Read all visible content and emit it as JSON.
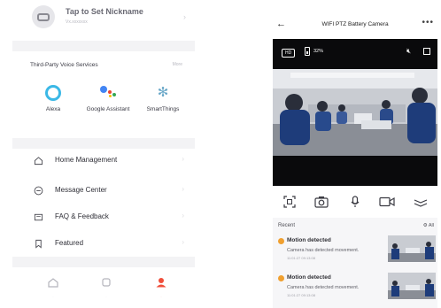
{
  "me_screen": {
    "profile": {
      "title": "Tap to Set Nickname",
      "subtitle": "Vx.xxxxxxx"
    },
    "voice_services": {
      "title": "Third-Party Voice Services",
      "more": "More",
      "items": [
        {
          "label": "Alexa",
          "icon": "alexa-icon"
        },
        {
          "label": "Google Assistant",
          "icon": "google-assistant-icon"
        },
        {
          "label": "SmartThings",
          "icon": "smartthings-icon"
        }
      ]
    },
    "menu": [
      {
        "label": "Home Management",
        "icon": "home-icon"
      },
      {
        "label": "Message Center",
        "icon": "message-icon"
      },
      {
        "label": "FAQ & Feedback",
        "icon": "feedback-icon"
      },
      {
        "label": "Featured",
        "icon": "bookmark-icon"
      }
    ],
    "tabs": [
      {
        "icon": "home-tab-icon"
      },
      {
        "icon": "smart-tab-icon"
      },
      {
        "icon": "me-tab-icon",
        "active": true
      }
    ],
    "accent_color": "#f04e3a"
  },
  "camera_screen": {
    "title": "WIFI PTZ Battery Camera",
    "video": {
      "quality_badge": "HD",
      "battery_pct": "32%",
      "battery_level": 0.32
    },
    "controls": [
      {
        "icon": "screenshot-icon"
      },
      {
        "icon": "camera-icon"
      },
      {
        "icon": "microphone-icon"
      },
      {
        "icon": "video-record-icon"
      },
      {
        "icon": "collapse-icon"
      }
    ],
    "recent": {
      "label": "Recent",
      "all_label": "All",
      "events": [
        {
          "title": "Motion detected",
          "desc": "Camera has detected movement.",
          "time": "11:01:27 09:13:08"
        },
        {
          "title": "Motion detected",
          "desc": "Camera has detected movement.",
          "time": "11:01:27 09:13:08"
        }
      ],
      "event_dot_color": "#f0a030"
    }
  }
}
